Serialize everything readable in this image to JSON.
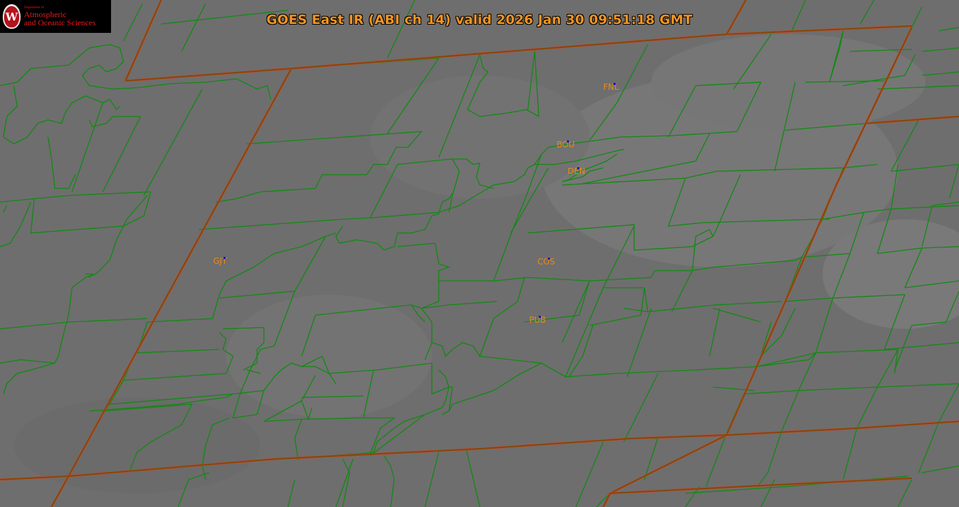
{
  "title": "GOES East IR (ABI ch 14) valid 2026 Jan 30 09:51:18 GMT",
  "logo": {
    "dept": "Department of",
    "line1": "Atmospheric",
    "line2": "and Oceanic Sciences",
    "seal_letter": "W"
  },
  "stations": [
    "FNL",
    "BOU",
    "DEN",
    "GJT",
    "COS",
    "PUB"
  ],
  "colors": {
    "background": "#6e6e6e",
    "county_lines": "#0f8a0f",
    "state_lines": "#7a4a12",
    "state_line_edge": "#e0401a",
    "title": "#f39421",
    "station_label": "#e98a1a",
    "station_marker": "#1010c0"
  }
}
